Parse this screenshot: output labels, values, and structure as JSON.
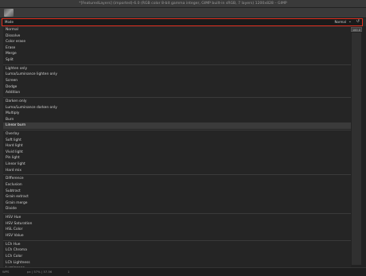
{
  "window": {
    "title": "*[FeaturedLayers] (imported)-6.0 (RGB color 8-bit gamma integer, GIMP built-in sRGB, 7 layers) 1200x828 – GIMP"
  },
  "modebar": {
    "label": "Mode",
    "selected": "Normal",
    "chevron": "chevron-down-icon",
    "reset": "reset-icon"
  },
  "panel": {
    "percent": "100.0"
  },
  "menu": {
    "groups": [
      [
        "Normal",
        "Dissolve",
        "Color erase",
        "Erase",
        "Merge",
        "Split"
      ],
      [
        "Lighten only",
        "Luma/Luminance lighten only",
        "Screen",
        "Dodge",
        "Addition"
      ],
      [
        "Darken only",
        "Luma/Luminance darken only",
        "Multiply",
        "Burn",
        "Linear burn"
      ],
      [
        "Overlay",
        "Soft light",
        "Hard light",
        "Vivid light",
        "Pin light",
        "Linear light",
        "Hard mix"
      ],
      [
        "Difference",
        "Exclusion",
        "Subtract",
        "Grain extract",
        "Grain merge",
        "Divide"
      ],
      [
        "HSV Hue",
        "HSV Saturation",
        "HSL Color",
        "HSV Value"
      ],
      [
        "LCh Hue",
        "LCh Chroma",
        "LCh Color",
        "LCh Lightness",
        "Luminance"
      ]
    ],
    "selected_item": "Linear burn"
  },
  "status": {
    "left": "WPS",
    "mid": "px  | 57%  | 57.56",
    "right": "1"
  },
  "colors": {
    "highlight": "#e03020",
    "background": "#252525"
  }
}
